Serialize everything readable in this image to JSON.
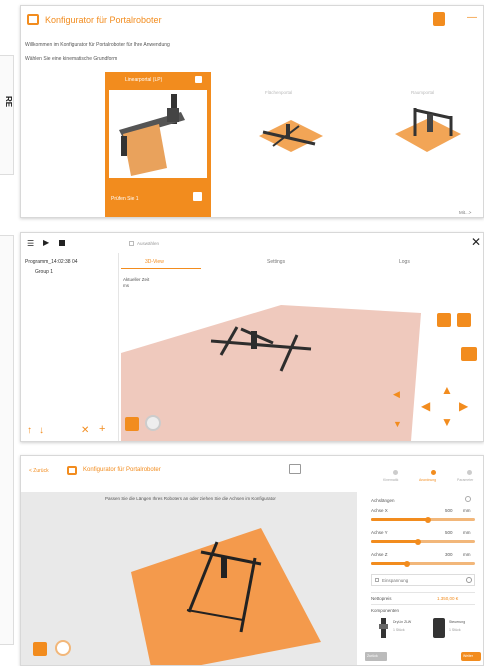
{
  "colors": {
    "accent": "#f28c1e",
    "floor_pink": "#efc9bd",
    "floor_orange": "#f49a4c",
    "text": "#444444"
  },
  "left_stub": {
    "text": "RE"
  },
  "panel1": {
    "title": "Konfigurator für Portalroboter",
    "intro": "Willkommen im Konfigurator für Portalroboter für Ihre Anwendung",
    "prompt": "Wählen Sie eine kinematische Grundform",
    "card_selected": {
      "title": "Linearportal (LP)",
      "label": "Prüfen Sie 1"
    },
    "card2_title": "Flächenportal",
    "card3_title": "Raumportal",
    "footer": "Mit...>"
  },
  "panel2": {
    "checkbox_label": "Auswählen",
    "tree": {
      "program": "Programm_14:02:38 04",
      "group": "Group 1"
    },
    "tabs": [
      "3D-View",
      "Settings",
      "Logs"
    ],
    "view_label_1": "Aktueller Zeit",
    "view_label_2": "Sekunden",
    "view_label_3": "ms"
  },
  "panel3": {
    "back_link": "< Zurück",
    "title": "Konfigurator für Portalroboter",
    "steps": [
      "Kinematik",
      "Anordnung",
      "Parameter"
    ],
    "instruction": "Passen Sie die Längen Ihres Roboters an oder ziehen Sie die Achsen im Konfigurator",
    "sidebar": {
      "header": "Achslängen",
      "sliders": [
        {
          "label": "Achse X",
          "value": "500",
          "unit": "mm",
          "level": 0.55
        },
        {
          "label": "Achse Y",
          "value": "500",
          "unit": "mm",
          "level": 0.45
        },
        {
          "label": "Achse Z",
          "value": "300",
          "unit": "mm",
          "level": 0.35
        }
      ],
      "checkbox_label": "Einspannung",
      "price_label": "Nettopreis",
      "price_value": "1.350,00 €",
      "components_header": "Komponenten",
      "component1": {
        "name": "DryLin ZLW",
        "sub": "1 Stück"
      },
      "component2": {
        "name": "Steuerung",
        "sub": "1 Stück"
      },
      "back_btn": "Zurück",
      "next_btn": "Weiter"
    }
  }
}
